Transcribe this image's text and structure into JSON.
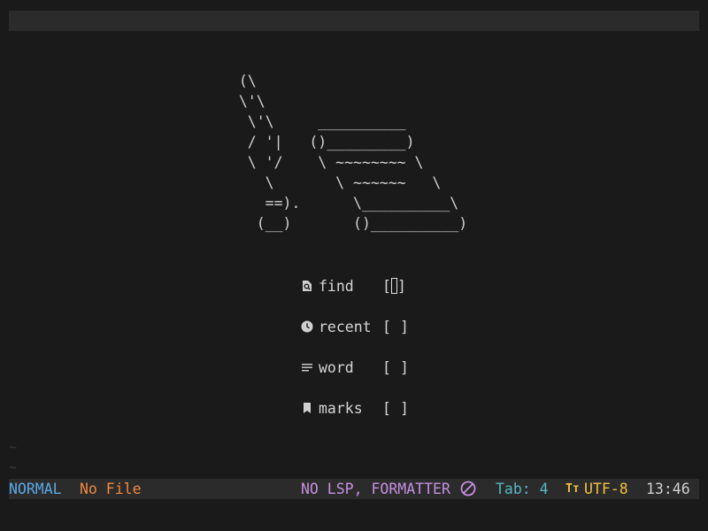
{
  "ascii_art": "  (\\\n  \\'\\\n   \\'\\     __________\n   / '|   ()_________)\n   \\ '/    \\ ~~~~~~~~ \\\n     \\       \\ ~~~~~~   \\\n     ==).      \\__________\\\n    (__)       ()__________)",
  "menu": [
    {
      "icon": "file-search-icon",
      "label": "find",
      "key_open": "[",
      "key_close": "]",
      "active": true
    },
    {
      "icon": "clock-icon",
      "label": "recent",
      "key_open": "[",
      "key_close": "]",
      "active": false
    },
    {
      "icon": "lines-icon",
      "label": "word",
      "key_open": "[",
      "key_close": "]",
      "active": false
    },
    {
      "icon": "bookmark-icon",
      "label": "marks",
      "key_open": "[",
      "key_close": "]",
      "active": false
    }
  ],
  "tildes": [
    "~",
    "~"
  ],
  "status": {
    "mode": "NORMAL",
    "file": "No File",
    "lsp": "NO LSP, FORMATTER",
    "lsp_icon": "ban-icon",
    "tab": "Tab: 4",
    "encoding_icon_text": "Tт",
    "encoding": "UTF-8",
    "time": "13:46"
  },
  "colors": {
    "background": "#1a1a1a",
    "bar": "#2b2b2b",
    "mode": "#5aa9e6",
    "file": "#f0883e",
    "lsp": "#c78fe0",
    "tab": "#56b6c2",
    "encoding": "#f0c040"
  }
}
